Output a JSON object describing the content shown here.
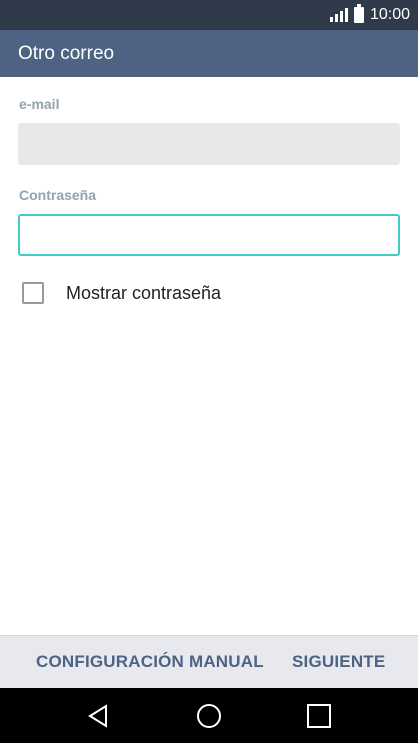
{
  "status_bar": {
    "time": "10:00",
    "icons": [
      "signal-icon",
      "battery-icon"
    ]
  },
  "app_bar": {
    "title": "Otro correo"
  },
  "form": {
    "email": {
      "label": "e-mail",
      "value": ""
    },
    "password": {
      "label": "Contraseña",
      "value": ""
    },
    "show_password": {
      "label": "Mostrar contraseña",
      "checked": false
    }
  },
  "actions": {
    "manual_config_label": "CONFIGURACIÓN MANUAL",
    "next_label": "SIGUIENTE"
  },
  "nav": {
    "icons": [
      "back-icon",
      "home-icon",
      "recents-icon"
    ]
  },
  "colors": {
    "status_bar": "#2f3a4b",
    "app_bar": "#4e6283",
    "focus_accent": "#43c9c6",
    "label": "#93a3ae",
    "action_text": "#4e6283"
  }
}
